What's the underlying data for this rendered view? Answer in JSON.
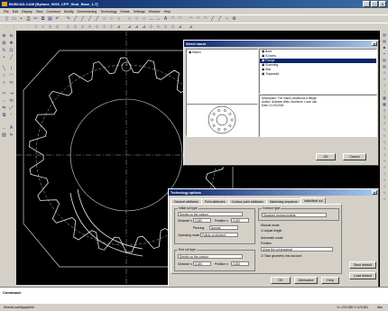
{
  "app": {
    "title": "BOBCAD-CAM [Bybase_0000_CPP_Stub_Base_1-7]",
    "window_buttons": [
      "_",
      "□",
      "×"
    ]
  },
  "menu": [
    "File",
    "Edit",
    "Display",
    "View",
    "Construct",
    "Modify",
    "Dimensioning",
    "Technology",
    "Extras",
    "Settings",
    "Window",
    "Help"
  ],
  "toolbar1_icons": [
    "new-icon",
    "open-icon",
    "save-icon",
    "print-icon",
    "cut-icon",
    "copy-icon",
    "paste-icon",
    "undo-icon",
    "redo-icon",
    "line-icon",
    "line-icon",
    "line-icon",
    "line-icon",
    "circle-icon",
    "circle-icon",
    "circle-icon",
    "circle-icon",
    "circle-icon",
    "circle-icon",
    "dimension-icon",
    "dimension-icon",
    "text-icon",
    "arc-icon",
    "arc-icon",
    "arc-icon",
    "arc-icon",
    "arc-icon",
    "line-icon",
    "line-icon",
    "circle-icon",
    "gear-icon"
  ],
  "toolbar2_icons": [
    "point-icon",
    "point-icon",
    "point-icon",
    "point-icon",
    "circle-icon",
    "circle-icon",
    "snap-icon",
    "snap-icon",
    "snap-icon",
    "snap-icon",
    "snap-icon",
    "snap-icon",
    "snap-icon",
    "snap-icon",
    "snap-icon",
    "measure-icon",
    "measure-icon",
    "measure-icon",
    "measure-icon",
    "snap-icon",
    "snap-icon",
    "snap-icon",
    "snap-icon",
    "measure-icon",
    "measure-icon"
  ],
  "select_macro": {
    "title": "Select macro",
    "close": "×",
    "tree_root": "Macro",
    "tree_items": [
      "Bore",
      "S-holes",
      "Flange",
      "Scanning",
      "Star",
      "Trapezoid"
    ],
    "description": "Description: The macro constructs a flange.\nAuthor: Andreas Weis, Bochinck, Lowe Lab\nDate: 01.03.2004",
    "ok": "OK",
    "cancel": "Cancel"
  },
  "tech": {
    "title": "Technology options",
    "close": "×",
    "tabs": [
      "General attributes",
      "Point attributes",
      "Contour point attributes",
      "Machining sequence",
      "Initial/final cut"
    ],
    "active_tab": 4,
    "initial_cut_group": "Initial cut type",
    "initial_cut_value": "Directly on the contour",
    "distance_label": "Distance x",
    "distance_value": "0.000",
    "position_label": "Position x",
    "position_value": "0.000",
    "piercing_label": "Piercing",
    "piercing_value": "Normal",
    "operating_mode_label": "Operating mode",
    "operating_mode_value": "Follow on element",
    "final_cut_group": "End cut type",
    "final_cut_value": "Directly on the contour",
    "contour_type_group": "Contour type",
    "contour_type_value": "Standard contour/outside",
    "manual_mode_label": "Manual mode",
    "adjust_length": "Adjust length",
    "auto_mode_label": "Automatic mode",
    "auto_position_label": "Position",
    "auto_position_value": "Along the cut sequence",
    "take_geometry": "Take geometry into account",
    "ok": "OK",
    "alternative": "Alternative",
    "help": "Help",
    "save_default": "Save default",
    "load_default": "Load default"
  },
  "command": {
    "label": "Command:"
  },
  "status": {
    "left": "Select/Load/Apply/Info",
    "coords": "X=-274.055  Y=175.811",
    "mode": "Abs"
  }
}
